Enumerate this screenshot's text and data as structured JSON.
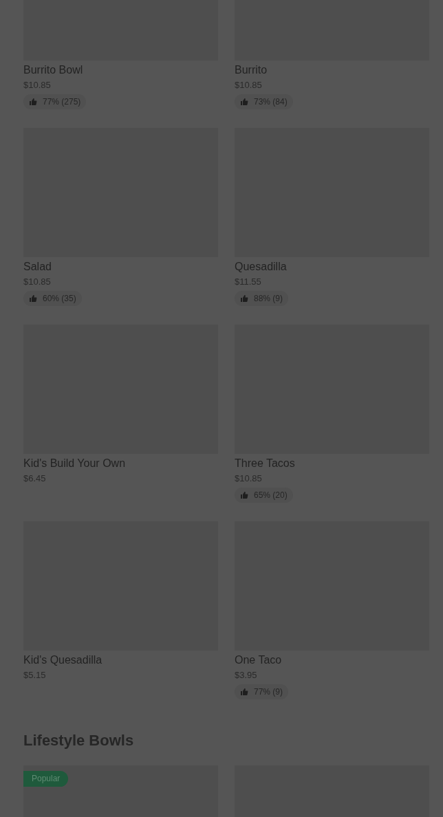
{
  "menu_items": [
    {
      "name": "Burrito Bowl",
      "price": "$10.85",
      "rating": "77% (275)"
    },
    {
      "name": "Burrito",
      "price": "$10.85",
      "rating": "73% (84)"
    },
    {
      "name": "Salad",
      "price": "$10.85",
      "rating": "60% (35)"
    },
    {
      "name": "Quesadilla",
      "price": "$11.55",
      "rating": "88% (9)"
    },
    {
      "name": "Kid's Build Your Own",
      "price": "$6.45"
    },
    {
      "name": "Three Tacos",
      "price": "$10.85",
      "rating": "65% (20)"
    },
    {
      "name": "Kid's Quesadilla",
      "price": "$5.15"
    },
    {
      "name": "One Taco",
      "price": "$3.95",
      "rating": "77% (9)"
    }
  ],
  "section": {
    "title": "Lifestyle Bowls",
    "items": [
      {
        "popular": true,
        "badge": "Popular"
      },
      {
        "popular": false
      }
    ]
  }
}
